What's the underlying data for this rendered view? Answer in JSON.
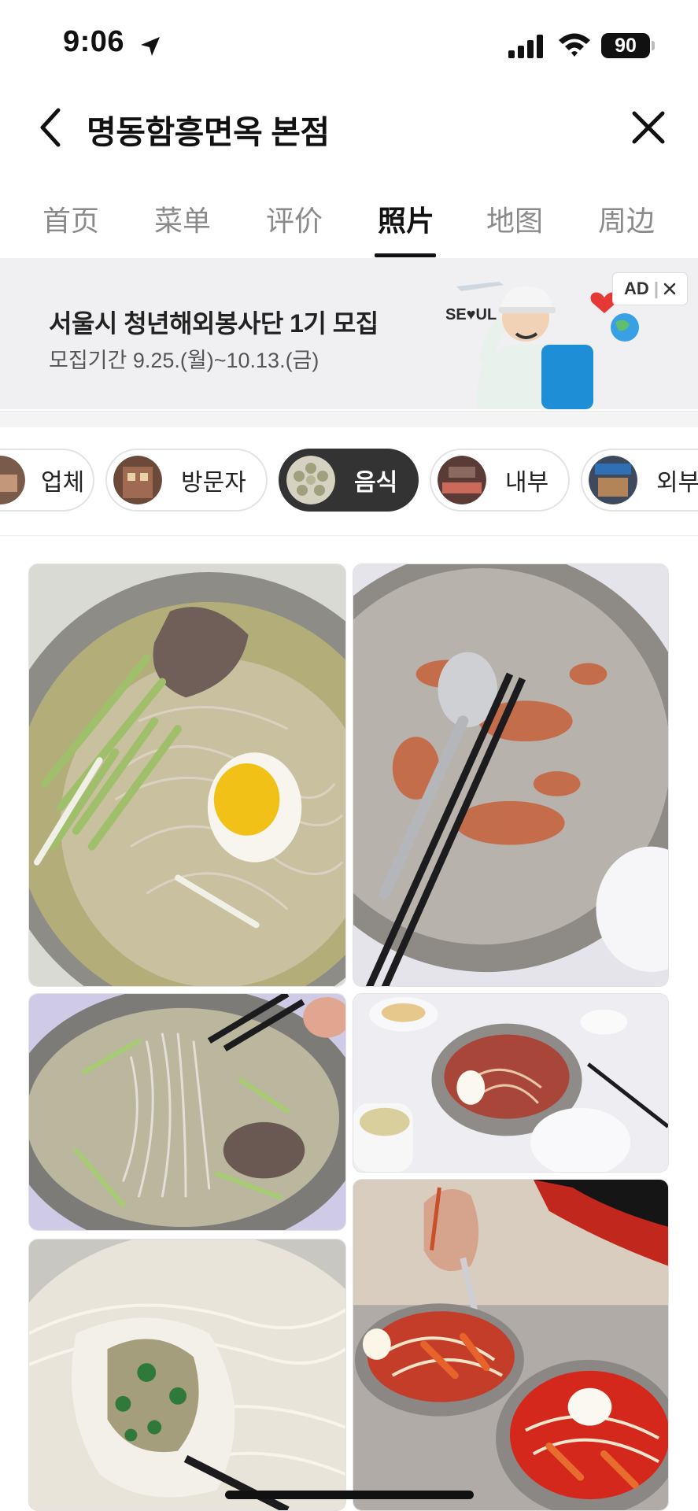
{
  "status_bar": {
    "time": "9:06",
    "battery": "90"
  },
  "header": {
    "title": "명동함흥면옥 본점"
  },
  "tabs": [
    {
      "label": "首页",
      "active": false
    },
    {
      "label": "菜单",
      "active": false
    },
    {
      "label": "评价",
      "active": false
    },
    {
      "label": "照片",
      "active": true
    },
    {
      "label": "地图",
      "active": false
    },
    {
      "label": "周边",
      "active": false
    }
  ],
  "ad": {
    "title": "서울시 청년해외봉사단 1기 모집",
    "subtitle": "모집기간 9.25.(월)~10.13.(금)",
    "badge": "AD",
    "logo_text": "SE♥UL"
  },
  "filters": [
    {
      "label": "업체",
      "active": false
    },
    {
      "label": "방문자",
      "active": false
    },
    {
      "label": "음식",
      "active": true
    },
    {
      "label": "내부",
      "active": false
    },
    {
      "label": "외부",
      "active": false
    }
  ],
  "photos": [
    {
      "subject": "mul-naengmyeon-egg-bowl"
    },
    {
      "subject": "empty-bowl-spoon-chopsticks"
    },
    {
      "subject": "noodles-lifted-chopsticks"
    },
    {
      "subject": "bibim-naengmyeon-table"
    },
    {
      "subject": "noodles-with-dumpling"
    },
    {
      "subject": "two-spicy-noodle-bowls"
    }
  ]
}
